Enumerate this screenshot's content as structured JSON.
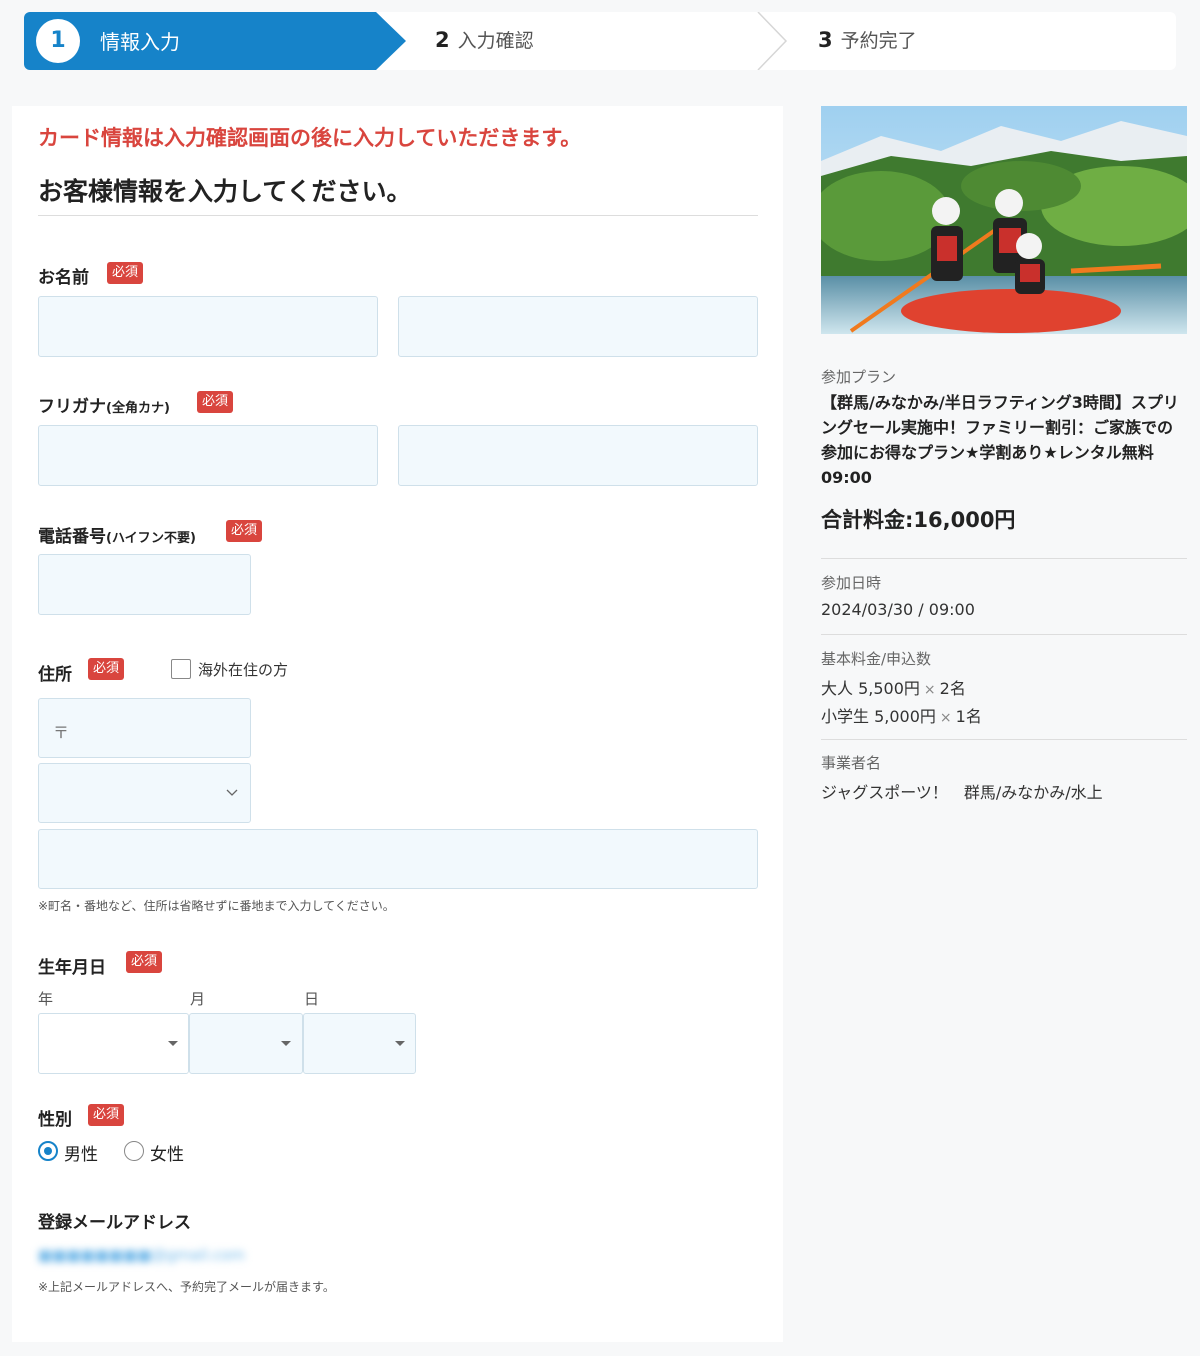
{
  "stepper": {
    "steps": [
      {
        "num": "1",
        "label": "情報入力"
      },
      {
        "num": "2",
        "label": "入力確認"
      },
      {
        "num": "3",
        "label": "予約完了"
      }
    ]
  },
  "form": {
    "notice": "カード情報は入力確認画面の後に入力していただきます。",
    "heading": "お客様情報を入力してください。",
    "required_badge": "必須",
    "name_label": "お名前",
    "kana_label": "フリガナ",
    "kana_suffix": "(全角カナ)",
    "phone_label": "電話番号",
    "phone_suffix": "(ハイフン不要)",
    "address_label": "住所",
    "overseas_label": "海外在住の方",
    "postal_placeholder": "〒",
    "address_note": "※町名・番地など、住所は省略せずに番地まで入力してください。",
    "birth_label": "生年月日",
    "birth_year": "年",
    "birth_month": "月",
    "birth_day": "日",
    "gender_label": "性別",
    "gender_options": [
      "男性",
      "女性"
    ],
    "gender_selected": "男性",
    "email_label": "登録メールアドレス",
    "email_value": "■■■■■■■■@gmail.com",
    "email_note": "※上記メールアドレスへ、予約完了メールが届きます。"
  },
  "sidebar": {
    "plan_label": "参加プラン",
    "plan_title": "【群馬/みなかみ/半日ラフティング3時間】スプリングセール実施中！ファミリー割引：ご家族での参加にお得なプラン★学割あり★レンタル無料 09:00",
    "total": "合計料金:16,000円",
    "date_label": "参加日時",
    "date_value": "2024/03/30 / 09:00",
    "fee_label": "基本料金/申込数",
    "fees": [
      {
        "name": "大人 5,500円",
        "qty": "2名"
      },
      {
        "name": "小学生 5,000円",
        "qty": "1名"
      }
    ],
    "times": "×",
    "operator_label": "事業者名",
    "operator_value": "ジャグスポーツ！　群馬/みなかみ/水上"
  },
  "colors": {
    "accent": "#1683c9",
    "required": "#d9453e",
    "input_bg": "#f2f9fd"
  }
}
